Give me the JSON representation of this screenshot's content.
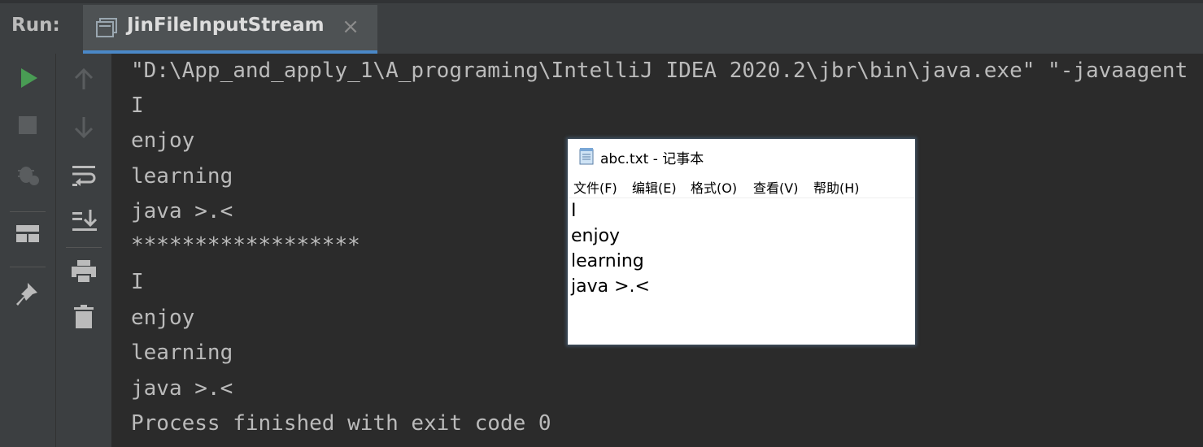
{
  "run_panel": {
    "label": "Run:",
    "tab": {
      "title": "JinFileInputStream",
      "icon": "console-icon",
      "close_glyph": "×"
    }
  },
  "toolbar_left": [
    "run-icon",
    "stop-icon",
    "debug-icon",
    "layout-icon",
    "pin-icon"
  ],
  "toolbar_right": [
    "up-arrow-icon",
    "down-arrow-icon",
    "soft-wrap-icon",
    "scroll-to-end-icon",
    "print-icon",
    "trash-icon"
  ],
  "console": {
    "lines": [
      "\"D:\\App_and_apply_1\\A_programing\\IntelliJ IDEA 2020.2\\jbr\\bin\\java.exe\" \"-javaagent",
      "I",
      "enjoy",
      "learning",
      "java >.<",
      "******************",
      "I",
      "enjoy",
      "learning",
      "java >.<",
      "Process finished with exit code 0"
    ]
  },
  "notepad": {
    "title": "abc.txt - 记事本",
    "menu": [
      "文件(F)",
      "编辑(E)",
      "格式(O)",
      "查看(V)",
      "帮助(H)"
    ],
    "content": [
      "I",
      "enjoy",
      "learning",
      "java >.<"
    ]
  },
  "colors": {
    "panel_bg": "#3c3f41",
    "console_bg": "#2b2b2b",
    "console_text": "#bbbbbb",
    "tab_bg": "#4e5254",
    "tab_accent": "#4a88c7",
    "run_green": "#499c54"
  }
}
